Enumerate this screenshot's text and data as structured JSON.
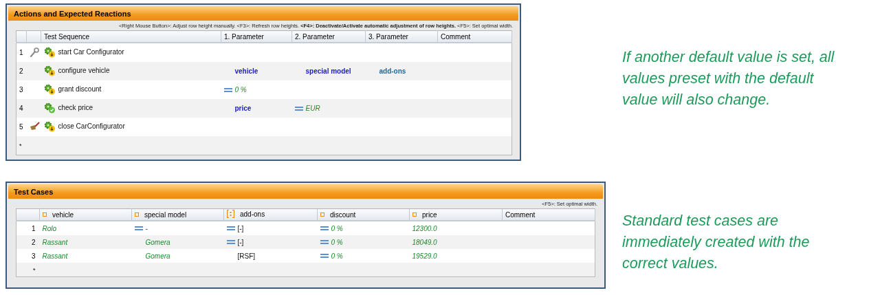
{
  "panels": [
    {
      "title": "Actions and Expected Reactions",
      "hint": "<Right Mouse Button>: Adjust row height manually. <F3>: Refresh row heights. **<F4>: Deactivate/Activate automatic adjustment of row heights.** <F5>: Set optimal width.",
      "kind": "sequence",
      "columns": [
        {
          "label": "Test Sequence"
        },
        {
          "label": "1. Parameter"
        },
        {
          "label": "2. Parameter"
        },
        {
          "label": "3. Parameter"
        },
        {
          "label": "Comment"
        }
      ],
      "rows": [
        {
          "number": "1",
          "row_icon": {
            "kind": "wrench"
          },
          "step_icon": {
            "kind": "action"
          },
          "cells": [
            {
              "text": "start Car Configurator",
              "kind": "step"
            }
          ]
        },
        {
          "number": "2",
          "step_icon": {
            "kind": "action"
          },
          "cells": [
            {
              "text": "configure vehicle",
              "kind": "step"
            },
            {
              "text": "vehicle",
              "kind": "variable"
            },
            {
              "text": "special model",
              "kind": "variable"
            },
            {
              "text": "add-ons",
              "kind": "list_variable"
            }
          ]
        },
        {
          "number": "3",
          "step_icon": {
            "kind": "action"
          },
          "cells": [
            {
              "text": "grant discount",
              "kind": "step"
            },
            {
              "text": "0 %",
              "kind": "default_value"
            }
          ]
        },
        {
          "number": "4",
          "step_icon": {
            "kind": "check"
          },
          "cells": [
            {
              "text": "check price",
              "kind": "step"
            },
            {
              "text": "price",
              "kind": "variable"
            },
            {
              "text": "EUR",
              "kind": "default_value"
            }
          ]
        },
        {
          "number": "5",
          "row_icon": {
            "kind": "broom"
          },
          "step_icon": {
            "kind": "action"
          },
          "cells": [
            {
              "text": "close CarConfigurator",
              "kind": "step"
            }
          ]
        }
      ],
      "new_row": "*"
    },
    {
      "title": "Test Cases",
      "hint": "<F5>: Set optimal width.",
      "kind": "cases",
      "columns": [
        {
          "label": "vehicle",
          "kind": "variable"
        },
        {
          "label": "special model",
          "kind": "variable"
        },
        {
          "label": "add-ons",
          "kind": "list"
        },
        {
          "label": "discount",
          "kind": "variable"
        },
        {
          "label": "price",
          "kind": "variable"
        },
        {
          "label": "Comment"
        }
      ],
      "rows": [
        {
          "number": "1",
          "cells": [
            {
              "text": "Rolo",
              "kind": "value"
            },
            {
              "text": "-",
              "kind": "default_value"
            },
            {
              "text": "[-]",
              "kind": "default_plain"
            },
            {
              "text": "0 %",
              "kind": "default_value"
            },
            {
              "text": "12300.0",
              "kind": "value"
            }
          ]
        },
        {
          "number": "2",
          "cells": [
            {
              "text": "Rassant",
              "kind": "value"
            },
            {
              "text": "Gomera",
              "kind": "set_value"
            },
            {
              "text": "[-]",
              "kind": "default_plain"
            },
            {
              "text": "0 %",
              "kind": "default_value"
            },
            {
              "text": "18049.0",
              "kind": "value"
            }
          ]
        },
        {
          "number": "3",
          "cells": [
            {
              "text": "Rassant",
              "kind": "value"
            },
            {
              "text": "Gomera",
              "kind": "set_value"
            },
            {
              "text": "[RSF]",
              "kind": "set_plain"
            },
            {
              "text": "0 %",
              "kind": "default_value"
            },
            {
              "text": "19529.0",
              "kind": "value"
            }
          ]
        }
      ],
      "new_row": "*"
    }
  ],
  "captions": [
    "If another default value is set, all values preset with the default value will also change.",
    "Standard test cases are immediately created with the correct values."
  ]
}
